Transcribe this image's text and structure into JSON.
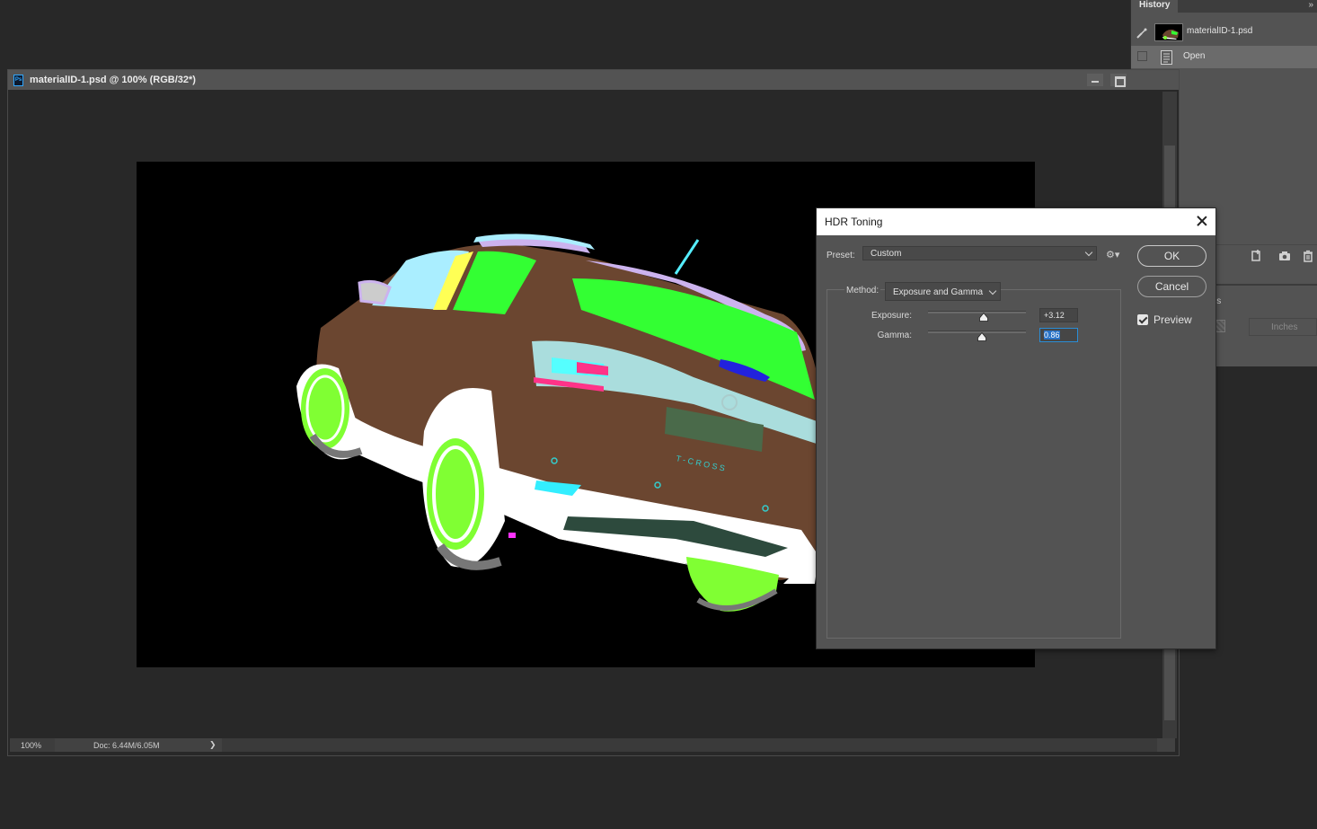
{
  "history_panel": {
    "tab_label": "History",
    "collapse_icon": "double-chevron-right-icon",
    "snapshot_label": "materialID-1.psd",
    "steps": [
      {
        "label": "Open"
      }
    ],
    "props_label": "ls",
    "units_value": "Inches"
  },
  "document": {
    "title": "materialID-1.psd @ 100% (RGB/32*)",
    "zoom": "100%",
    "doc_info": "Doc: 6.44M/6.05M",
    "status_arrow": "❯"
  },
  "dialog": {
    "title": "HDR Toning",
    "preset_label": "Preset:",
    "preset_value": "Custom",
    "method_label": "Method:",
    "method_value": "Exposure and Gamma",
    "exposure_label": "Exposure:",
    "exposure_value": "+3.12",
    "gamma_label": "Gamma:",
    "gamma_value": "0.86",
    "ok_label": "OK",
    "cancel_label": "Cancel",
    "preview_label": "Preview",
    "preview_checked": true
  },
  "colors": {
    "app_bg": "#282828",
    "panel_bg": "#535353",
    "accent": "#2a73c7"
  }
}
